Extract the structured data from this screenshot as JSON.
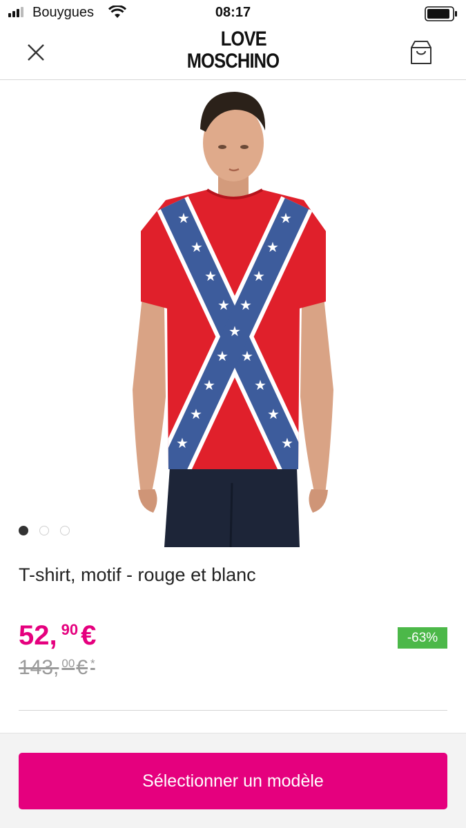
{
  "status_bar": {
    "carrier": "Bouygues",
    "time": "08:17",
    "signal_bars_active": 3,
    "signal_bars_total": 4,
    "battery_level": 0.8
  },
  "header": {
    "close_icon": "close-icon",
    "logo_line1": "LOVE",
    "logo_line2": "MOSCHINO",
    "bag_icon": "shopping-bag-icon"
  },
  "gallery": {
    "total_images": 3,
    "active_index": 0
  },
  "product": {
    "title": "T-shirt, motif - rouge et blanc",
    "price_whole": "52,",
    "price_cents": "90",
    "price_currency": "€",
    "old_price_whole": "143,",
    "old_price_cents": "00",
    "old_price_currency": "€",
    "old_price_asterisk": "*",
    "discount": "-63%"
  },
  "cta": {
    "label": "Sélectionner un modèle"
  },
  "colors": {
    "accent": "#e5007e",
    "discount_badge": "#4cb849",
    "shirt": "#e0202b",
    "cross": "#3d5c9c"
  }
}
